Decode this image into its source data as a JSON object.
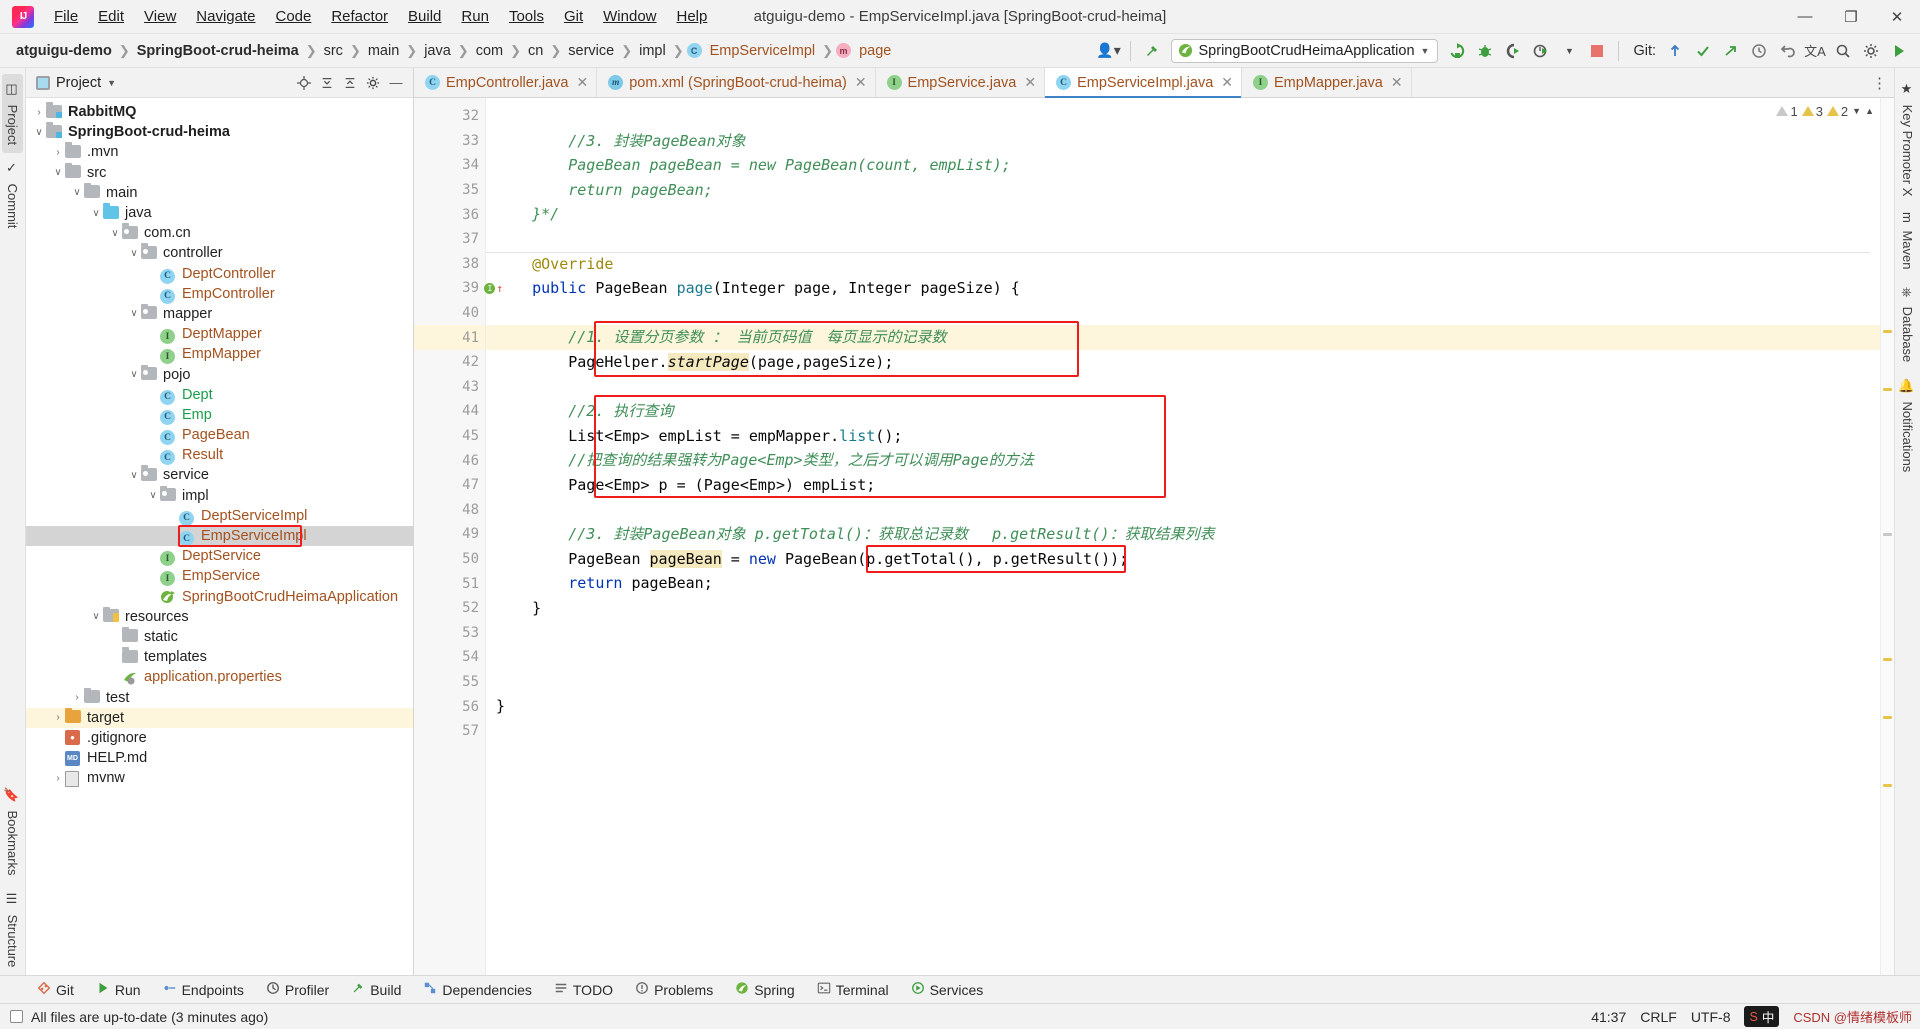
{
  "window": {
    "title": "atguigu-demo - EmpServiceImpl.java [SpringBoot-crud-heima]",
    "minimize": "—",
    "maximize": "❐",
    "close": "✕"
  },
  "menu": [
    {
      "label": "File"
    },
    {
      "label": "Edit"
    },
    {
      "label": "View"
    },
    {
      "label": "Navigate"
    },
    {
      "label": "Code"
    },
    {
      "label": "Refactor"
    },
    {
      "label": "Build"
    },
    {
      "label": "Run"
    },
    {
      "label": "Tools"
    },
    {
      "label": "Git"
    },
    {
      "label": "Window"
    },
    {
      "label": "Help"
    }
  ],
  "breadcrumb": [
    {
      "label": "atguigu-demo",
      "bold": true
    },
    {
      "label": "SpringBoot-crud-heima",
      "bold": true
    },
    {
      "label": "src"
    },
    {
      "label": "main"
    },
    {
      "label": "java"
    },
    {
      "label": "com"
    },
    {
      "label": "cn"
    },
    {
      "label": "service"
    },
    {
      "label": "impl"
    },
    {
      "label": "EmpServiceImpl",
      "icon": "class-icon",
      "orange": true
    },
    {
      "label": "page",
      "icon": "method-icon",
      "orange": true
    }
  ],
  "toolbar": {
    "run_config": "SpringBootCrudHeimaApplication",
    "git_label": "Git:",
    "icons": [
      "user-dropdown-icon",
      "build-hammer-icon",
      "rerun-icon",
      "debug-icon",
      "run-with-coverage-icon",
      "profiler-icon",
      "stop-icon",
      "git-update-icon",
      "git-commit-icon",
      "git-push-icon",
      "git-history-icon",
      "undo-icon",
      "translate-icon",
      "search-icon",
      "settings-icon",
      "run-icon"
    ]
  },
  "project_panel": {
    "title": "Project",
    "actions": [
      "locate-icon",
      "collapse-all-icon",
      "expand-icon",
      "settings-icon",
      "hide-icon"
    ],
    "tree": [
      {
        "depth": 1,
        "arrow": "›",
        "icon": "module-icon",
        "label": "RabbitMQ",
        "style": "bold"
      },
      {
        "depth": 1,
        "arrow": "∨",
        "icon": "module-icon",
        "label": "SpringBoot-crud-heima",
        "style": "bold"
      },
      {
        "depth": 2,
        "arrow": "›",
        "icon": "folder-icon",
        "label": ".mvn",
        "style": "plain"
      },
      {
        "depth": 2,
        "arrow": "∨",
        "icon": "folder-icon",
        "label": "src",
        "style": "plain"
      },
      {
        "depth": 3,
        "arrow": "∨",
        "icon": "folder-icon",
        "label": "main",
        "style": "plain"
      },
      {
        "depth": 4,
        "arrow": "∨",
        "icon": "source-folder-icon",
        "label": "java",
        "style": "plain"
      },
      {
        "depth": 5,
        "arrow": "∨",
        "icon": "package-icon",
        "label": "com.cn",
        "style": "plain"
      },
      {
        "depth": 6,
        "arrow": "∨",
        "icon": "package-icon",
        "label": "controller",
        "style": "plain"
      },
      {
        "depth": 7,
        "arrow": "",
        "icon": "class-icon",
        "label": "DeptController",
        "style": "orange"
      },
      {
        "depth": 7,
        "arrow": "",
        "icon": "class-icon",
        "label": "EmpController",
        "style": "orange"
      },
      {
        "depth": 6,
        "arrow": "∨",
        "icon": "package-icon",
        "label": "mapper",
        "style": "plain"
      },
      {
        "depth": 7,
        "arrow": "",
        "icon": "interface-icon",
        "label": "DeptMapper",
        "style": "orange"
      },
      {
        "depth": 7,
        "arrow": "",
        "icon": "interface-icon",
        "label": "EmpMapper",
        "style": "orange"
      },
      {
        "depth": 6,
        "arrow": "∨",
        "icon": "package-icon",
        "label": "pojo",
        "style": "plain"
      },
      {
        "depth": 7,
        "arrow": "",
        "icon": "class-icon",
        "label": "Dept",
        "style": "green"
      },
      {
        "depth": 7,
        "arrow": "",
        "icon": "class-icon",
        "label": "Emp",
        "style": "green"
      },
      {
        "depth": 7,
        "arrow": "",
        "icon": "class-icon",
        "label": "PageBean",
        "style": "orange"
      },
      {
        "depth": 7,
        "arrow": "",
        "icon": "class-icon",
        "label": "Result",
        "style": "orange"
      },
      {
        "depth": 6,
        "arrow": "∨",
        "icon": "package-icon",
        "label": "service",
        "style": "plain"
      },
      {
        "depth": 7,
        "arrow": "∨",
        "icon": "package-icon",
        "label": "impl",
        "style": "plain"
      },
      {
        "depth": 8,
        "arrow": "",
        "icon": "class-icon",
        "label": "DeptServiceImpl",
        "style": "orange"
      },
      {
        "depth": 8,
        "arrow": "",
        "icon": "class-icon",
        "label": "EmpServiceImpl",
        "style": "orange",
        "selected": true,
        "highlight": true
      },
      {
        "depth": 7,
        "arrow": "",
        "icon": "interface-icon",
        "label": "DeptService",
        "style": "orange"
      },
      {
        "depth": 7,
        "arrow": "",
        "icon": "interface-icon",
        "label": "EmpService",
        "style": "orange"
      },
      {
        "depth": 7,
        "arrow": "",
        "icon": "spring-boot-icon",
        "label": "SpringBootCrudHeimaApplication",
        "style": "orange"
      },
      {
        "depth": 4,
        "arrow": "∨",
        "icon": "resource-folder-icon",
        "label": "resources",
        "style": "plain"
      },
      {
        "depth": 5,
        "arrow": "",
        "icon": "folder-icon",
        "label": "static",
        "style": "plain"
      },
      {
        "depth": 5,
        "arrow": "",
        "icon": "folder-icon",
        "label": "templates",
        "style": "plain"
      },
      {
        "depth": 5,
        "arrow": "",
        "icon": "spring-properties-icon",
        "label": "application.properties",
        "style": "orange"
      },
      {
        "depth": 3,
        "arrow": "›",
        "icon": "folder-icon",
        "label": "test",
        "style": "plain"
      },
      {
        "depth": 2,
        "arrow": "›",
        "icon": "target-folder-icon",
        "label": "target",
        "style": "plain",
        "rowbg": "yellow"
      },
      {
        "depth": 2,
        "arrow": "",
        "icon": "gitignore-icon",
        "label": ".gitignore",
        "style": "plain"
      },
      {
        "depth": 2,
        "arrow": "",
        "icon": "markdown-icon",
        "label": "HELP.md",
        "style": "plain"
      },
      {
        "depth": 2,
        "arrow": "›",
        "icon": "file-icon",
        "label": "mvnw",
        "style": "plain"
      }
    ]
  },
  "left_strip": [
    {
      "label": "Project",
      "icon": "project-icon",
      "selected": true
    },
    {
      "label": "Commit",
      "icon": "commit-icon",
      "selected": false
    },
    {
      "label": "Bookmarks",
      "icon": "bookmarks-icon",
      "selected": false
    },
    {
      "label": "Structure",
      "icon": "structure-icon",
      "selected": false
    }
  ],
  "right_strip": [
    {
      "label": "Key Promoter X",
      "icon": "key-promoter-icon"
    },
    {
      "label": "Maven",
      "icon": "maven-icon"
    },
    {
      "label": "Database",
      "icon": "database-icon"
    },
    {
      "label": "Notifications",
      "icon": "notifications-icon"
    }
  ],
  "editor_tabs": [
    {
      "label": "EmpController.java",
      "icon": "class-icon",
      "active": false
    },
    {
      "label": "pom.xml (SpringBoot-crud-heima)",
      "icon": "maven-icon",
      "active": false
    },
    {
      "label": "EmpService.java",
      "icon": "interface-icon",
      "active": false
    },
    {
      "label": "EmpServiceImpl.java",
      "icon": "class-icon",
      "active": true
    },
    {
      "label": "EmpMapper.java",
      "icon": "interface-icon",
      "active": false
    }
  ],
  "inspections": {
    "warning_grey": "1",
    "warning_yellow": "3",
    "warning_weak": "2"
  },
  "code": {
    "first_line": 32,
    "lines": [
      {
        "n": 32,
        "tokens": []
      },
      {
        "n": 33,
        "tokens": [
          {
            "t": "        //3. 封装PageBean对象",
            "c": "cm"
          }
        ]
      },
      {
        "n": 34,
        "tokens": [
          {
            "t": "        PageBean pageBean = new PageBean(count, empList);",
            "c": "cm"
          }
        ]
      },
      {
        "n": 35,
        "tokens": [
          {
            "t": "        return pageBean;",
            "c": "cm"
          }
        ]
      },
      {
        "n": 36,
        "tokens": [
          {
            "t": "    }*/",
            "c": "cm"
          }
        ]
      },
      {
        "n": 37,
        "tokens": []
      },
      {
        "n": 38,
        "tokens": [
          {
            "t": "    @Override",
            "c": "an"
          }
        ]
      },
      {
        "n": 39,
        "tokens": [
          {
            "t": "    ",
            "c": "ty"
          },
          {
            "t": "public",
            "c": "k"
          },
          {
            "t": " PageBean ",
            "c": "ty"
          },
          {
            "t": "page",
            "c": "fn"
          },
          {
            "t": "(Integer page, Integer pageSize) {",
            "c": "ty"
          }
        ]
      },
      {
        "n": 40,
        "tokens": []
      },
      {
        "n": 41,
        "tokens": [
          {
            "t": "        //1. 设置分页参数 ： 当前页码值　每页显示的记录数",
            "c": "cm"
          }
        ],
        "current": true
      },
      {
        "n": 42,
        "tokens": [
          {
            "t": "        PageHelper.",
            "c": "ty"
          },
          {
            "t": "startPage",
            "c": "hlital"
          },
          {
            "t": "(page,pageSize);",
            "c": "ty"
          }
        ]
      },
      {
        "n": 43,
        "tokens": []
      },
      {
        "n": 44,
        "tokens": [
          {
            "t": "        //2. 执行查询",
            "c": "cm"
          }
        ]
      },
      {
        "n": 45,
        "tokens": [
          {
            "t": "        List<Emp> empList = empMapper.",
            "c": "ty"
          },
          {
            "t": "list",
            "c": "fn"
          },
          {
            "t": "();",
            "c": "ty"
          }
        ]
      },
      {
        "n": 46,
        "tokens": [
          {
            "t": "        //把查询的结果强转为Page<Emp>类型，之后才可以调用Page的方法",
            "c": "cm"
          }
        ]
      },
      {
        "n": 47,
        "tokens": [
          {
            "t": "        Page<Emp> p = (Page<Emp>) empList;",
            "c": "ty"
          }
        ]
      },
      {
        "n": 48,
        "tokens": []
      },
      {
        "n": 49,
        "tokens": [
          {
            "t": "        //3. 封装PageBean对象 p.getTotal()：获取总记录数　 p.getResult()：获取结果列表",
            "c": "cm"
          }
        ]
      },
      {
        "n": 50,
        "tokens": [
          {
            "t": "        PageBean ",
            "c": "ty"
          },
          {
            "t": "pageBean",
            "c": "hl"
          },
          {
            "t": " = ",
            "c": "ty"
          },
          {
            "t": "new",
            "c": "k"
          },
          {
            "t": " PageBean(p.getTotal(), p.getResult());",
            "c": "ty"
          }
        ]
      },
      {
        "n": 51,
        "tokens": [
          {
            "t": "        return pageBean;",
            "c": "k2"
          }
        ]
      },
      {
        "n": 52,
        "tokens": [
          {
            "t": "    }",
            "c": "ty"
          }
        ]
      },
      {
        "n": 53,
        "tokens": []
      },
      {
        "n": 54,
        "tokens": []
      },
      {
        "n": 55,
        "tokens": []
      },
      {
        "n": 56,
        "tokens": [
          {
            "t": "}",
            "c": "ty"
          }
        ]
      },
      {
        "n": 57,
        "tokens": []
      }
    ]
  },
  "bottom_tools": [
    {
      "label": "Git",
      "icon": "git-icon"
    },
    {
      "label": "Run",
      "icon": "run-icon"
    },
    {
      "label": "Endpoints",
      "icon": "endpoints-icon"
    },
    {
      "label": "Profiler",
      "icon": "profiler-icon"
    },
    {
      "label": "Build",
      "icon": "build-icon"
    },
    {
      "label": "Dependencies",
      "icon": "dependencies-icon"
    },
    {
      "label": "TODO",
      "icon": "todo-icon"
    },
    {
      "label": "Problems",
      "icon": "problems-icon"
    },
    {
      "label": "Spring",
      "icon": "spring-icon"
    },
    {
      "label": "Terminal",
      "icon": "terminal-icon"
    },
    {
      "label": "Services",
      "icon": "services-icon"
    }
  ],
  "statusbar": {
    "message": "All files are up-to-date (3 minutes ago)",
    "caret": "41:37",
    "line_sep": "CRLF",
    "encoding": "UTF-8",
    "ime": "中",
    "watermark": "CSDN @情绪模板师"
  }
}
